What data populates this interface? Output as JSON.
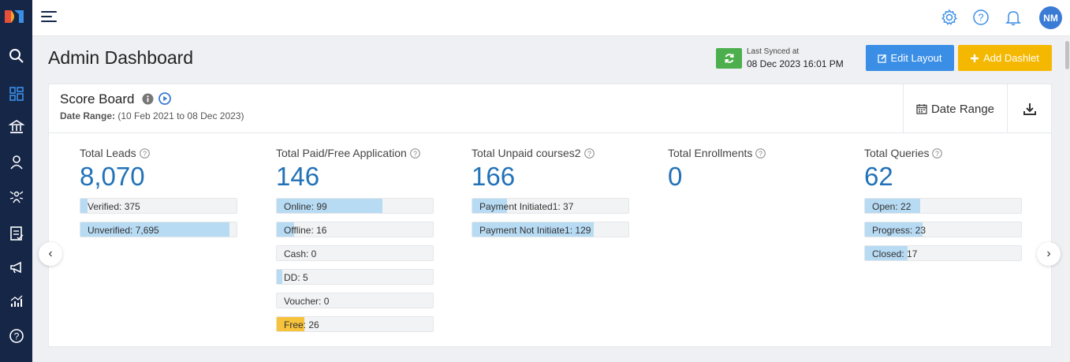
{
  "colors": {
    "sidebar_bg": "#152647",
    "accent_blue": "#3a8ee6",
    "accent_yellow": "#f5b800",
    "sync_green": "#4cae4c",
    "metric_blue": "#2272b8",
    "bar_blue": "#b8dbf4",
    "bar_yellow": "#f7c33b"
  },
  "sidebar": {
    "items": [
      {
        "icon": "search-icon"
      },
      {
        "icon": "dashboard-icon"
      },
      {
        "icon": "bank-icon"
      },
      {
        "icon": "user-icon"
      },
      {
        "icon": "network-icon"
      },
      {
        "icon": "checklist-icon"
      },
      {
        "icon": "megaphone-icon"
      },
      {
        "icon": "chart-icon"
      },
      {
        "icon": "help-icon"
      }
    ]
  },
  "topbar": {
    "avatar_initials": "NM",
    "icons": [
      "gear-icon",
      "help-icon",
      "bell-icon"
    ]
  },
  "header": {
    "title": "Admin Dashboard",
    "sync_label": "Last Synced at",
    "sync_time": "08 Dec 2023 16:01 PM",
    "edit_layout_label": "Edit Layout",
    "add_dashlet_label": "Add Dashlet"
  },
  "scoreboard": {
    "title": "Score Board",
    "date_range_label": "Date Range:",
    "date_range_value": "(10 Feb 2021 to 08 Dec 2023)",
    "date_range_button": "Date Range",
    "metrics": [
      {
        "title": "Total Leads",
        "value": "8,070",
        "bars": [
          {
            "label": "Verified: 375",
            "fraction": 0.046
          },
          {
            "label": "Unverified: 7,695",
            "fraction": 0.954
          }
        ]
      },
      {
        "title": "Total Paid/Free Application",
        "value": "146",
        "bars": [
          {
            "label": "Online: 99",
            "fraction": 0.678
          },
          {
            "label": "Offline: 16",
            "fraction": 0.11
          },
          {
            "label": "Cash: 0",
            "fraction": 0
          },
          {
            "label": "DD: 5",
            "fraction": 0.034
          },
          {
            "label": "Voucher: 0",
            "fraction": 0
          },
          {
            "label": "Free: 26",
            "fraction": 0.178,
            "color": "yellow"
          }
        ]
      },
      {
        "title": "Total Unpaid courses2",
        "value": "166",
        "bars": [
          {
            "label": "Payment Initiated1: 37",
            "fraction": 0.223
          },
          {
            "label": "Payment Not Initiate1: 129",
            "fraction": 0.777
          }
        ]
      },
      {
        "title": "Total Enrollments",
        "value": "0",
        "bars": []
      },
      {
        "title": "Total Queries",
        "value": "62",
        "bars": [
          {
            "label": "Open: 22",
            "fraction": 0.355
          },
          {
            "label": "Progress: 23",
            "fraction": 0.371
          },
          {
            "label": "Closed: 17",
            "fraction": 0.274
          }
        ]
      }
    ]
  }
}
